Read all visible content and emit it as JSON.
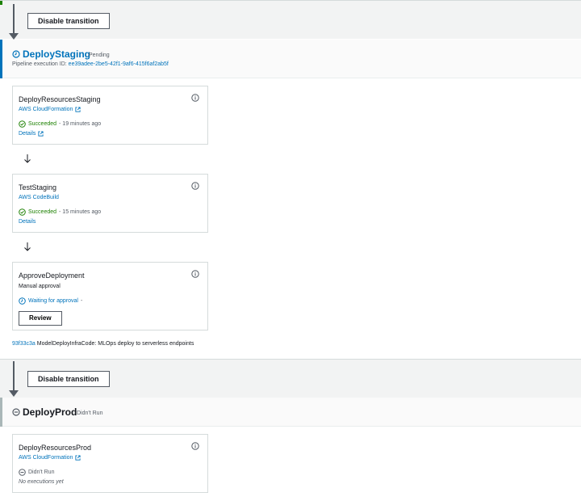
{
  "transition_top": {
    "button_label": "Disable transition"
  },
  "deploy_staging": {
    "title": "DeployStaging",
    "status": "Pending",
    "exec_label": "Pipeline execution ID:",
    "exec_id": "ee39adee-2be5-42f1-9af6-415f6af2ab5f",
    "actions": [
      {
        "name": "DeployResourcesStaging",
        "provider": "AWS CloudFormation",
        "status": "Succeeded",
        "time": "- 19 minutes ago",
        "details": "Details"
      },
      {
        "name": "TestStaging",
        "provider": "AWS CodeBuild",
        "status": "Succeeded",
        "time": "- 15 minutes ago",
        "details": "Details"
      },
      {
        "name": "ApproveDeployment",
        "provider": "Manual approval",
        "status": "Waiting for approval",
        "time": "-",
        "review": "Review"
      }
    ],
    "commit_id": "93f33c3a",
    "commit_message": "ModelDeployInfraCode: MLOps deploy to serverless endpoints"
  },
  "transition_bottom": {
    "button_label": "Disable transition"
  },
  "deploy_prod": {
    "title": "DeployProd",
    "status": "Didn't Run",
    "actions": [
      {
        "name": "DeployResourcesProd",
        "provider": "AWS CloudFormation",
        "status": "Didn't Run",
        "note": "No executions yet"
      }
    ]
  },
  "colors": {
    "link": "#0073bb",
    "success": "#1d8102",
    "border": "#d5dbdb",
    "band": "#f2f3f3"
  },
  "icons": [
    "info-icon",
    "external-link-icon",
    "check-circle-icon",
    "clock-icon",
    "minus-circle-icon",
    "arrow-down-icon"
  ]
}
